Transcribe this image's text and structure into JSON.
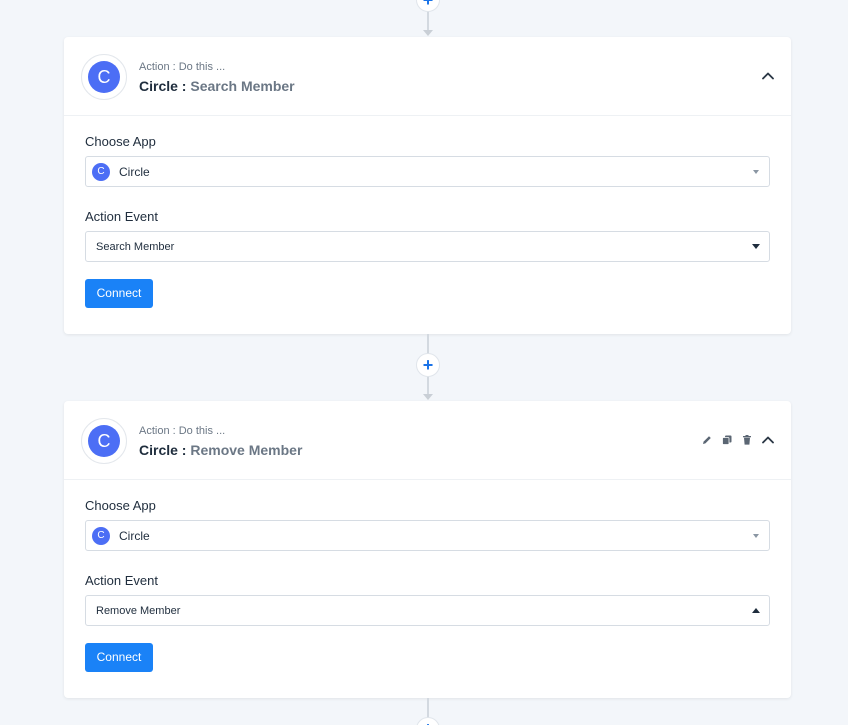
{
  "flow": {
    "add_step_symbol": "+"
  },
  "steps": [
    {
      "step_label": "Action : Do this ...",
      "app_name": "Circle :",
      "event_name": "Search Member",
      "avatar_letter": "C",
      "choose_app_label": "Choose App",
      "app_value": "Circle",
      "action_event_label": "Action Event",
      "action_event_value": "Search Member",
      "connect_label": "Connect"
    },
    {
      "step_label": "Action : Do this ...",
      "app_name": "Circle :",
      "event_name": "Remove Member",
      "avatar_letter": "C",
      "choose_app_label": "Choose App",
      "app_value": "Circle",
      "action_event_label": "Action Event",
      "action_event_value": "Remove Member",
      "connect_label": "Connect"
    }
  ],
  "colors": {
    "accent": "#1a82f7",
    "app_brand": "#4c6ef5",
    "background": "#f3f6fa"
  },
  "icons": {
    "step_header_icons": [
      "pencil-icon",
      "copy-icon",
      "trash-icon",
      "chevron-up-icon"
    ]
  }
}
